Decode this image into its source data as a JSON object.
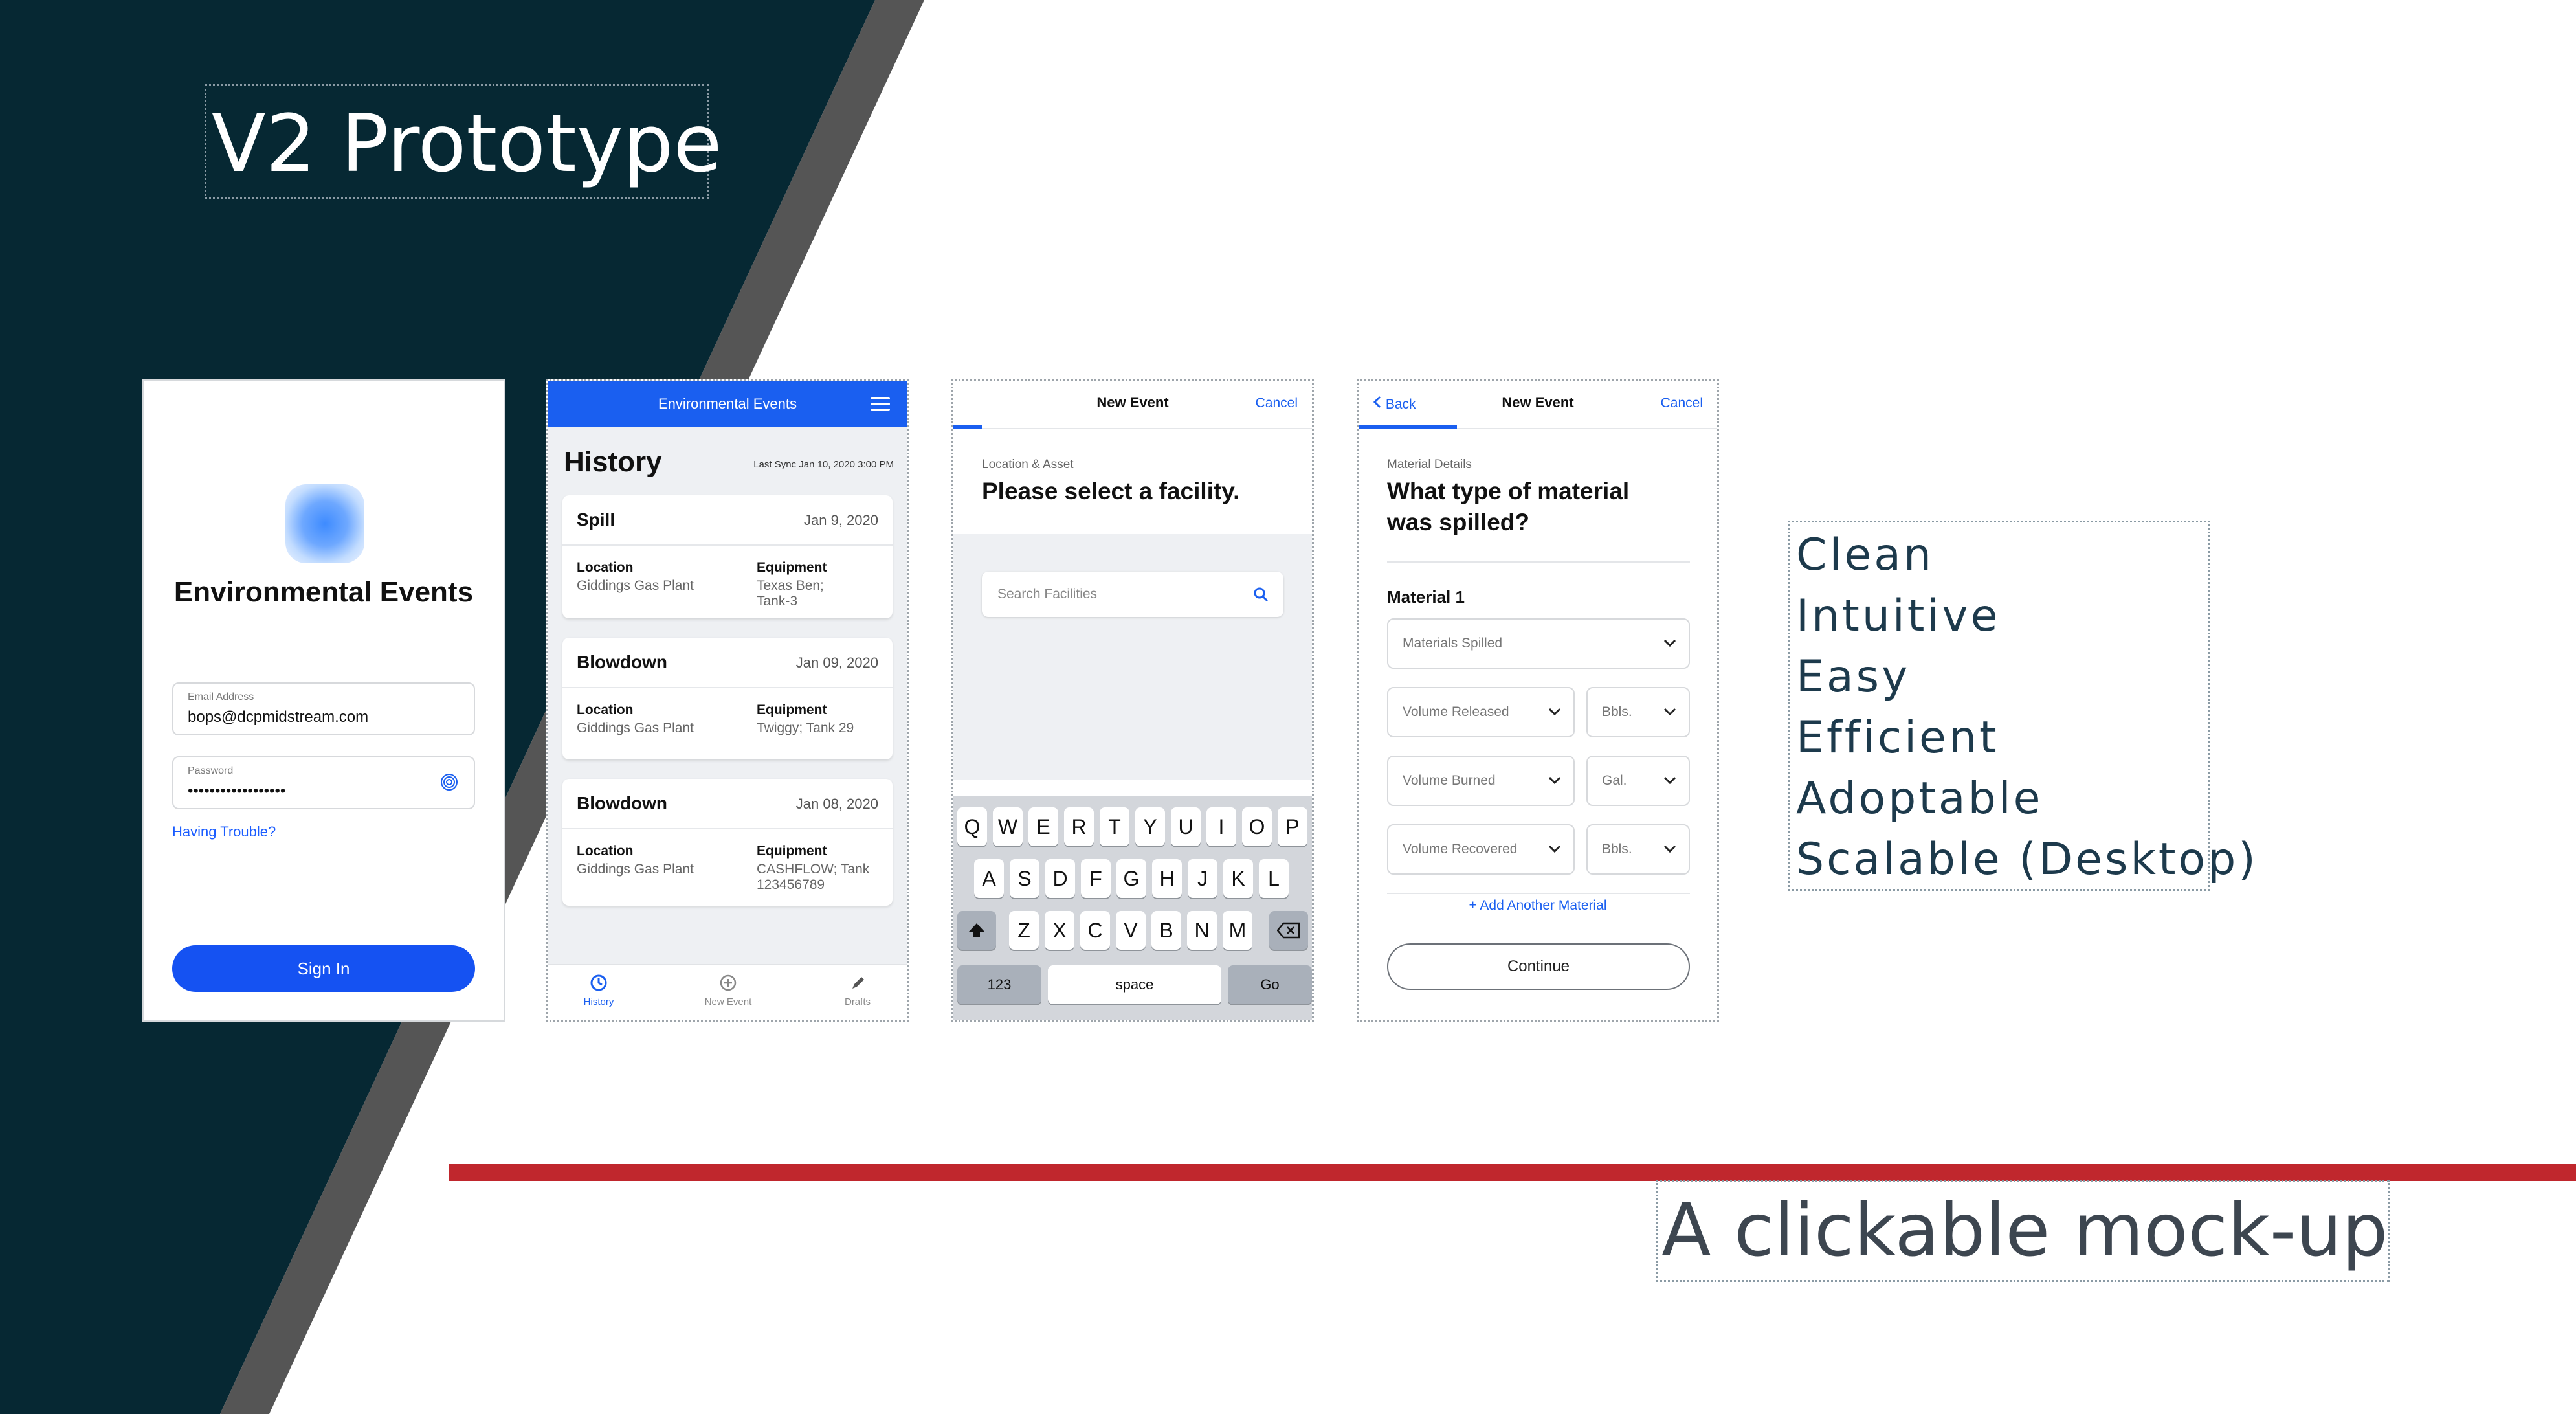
{
  "slide": {
    "title": "V2 Prototype",
    "features": [
      "Clean",
      "Intuitive",
      "Easy",
      "Efficient",
      "Adoptable",
      "Scalable (Desktop)"
    ],
    "subtitle": "A clickable  mock-up",
    "colors": {
      "dark_bg": "#062833",
      "stripe": "#555555",
      "accent_red": "#c0272d",
      "app_blue": "#1a5ff0"
    }
  },
  "login": {
    "app_name": "Environmental Events",
    "email_label": "Email Address",
    "email_value": "bops@dcpmidstream.com",
    "password_label": "Password",
    "password_value": "••••••••••••••••••",
    "trouble_link": "Having Trouble?",
    "sign_in": "Sign In",
    "icons": [
      "app-logo-icon",
      "fingerprint-icon"
    ]
  },
  "history": {
    "header": "Environmental Events",
    "title": "History",
    "last_sync": "Last Sync Jan 10, 2020 3:00 PM",
    "location_label": "Location",
    "equipment_label": "Equipment",
    "events": [
      {
        "type": "Spill",
        "date": "Jan 9, 2020",
        "location": "Giddings Gas Plant",
        "equipment": "Texas Ben; Tank-3"
      },
      {
        "type": "Blowdown",
        "date": "Jan 09, 2020",
        "location": "Giddings Gas Plant",
        "equipment": "Twiggy; Tank 29"
      },
      {
        "type": "Blowdown",
        "date": "Jan 08, 2020",
        "location": "Giddings Gas Plant",
        "equipment": "CASHFLOW; Tank 123456789"
      }
    ],
    "tabs": [
      "History",
      "New Event",
      "Drafts"
    ],
    "icons": [
      "menu-icon",
      "history-icon",
      "new-event-icon",
      "drafts-icon"
    ]
  },
  "facility": {
    "header": "New Event",
    "cancel": "Cancel",
    "section": "Location & Asset",
    "question": "Please select a facility.",
    "search_placeholder": "Search Facilities",
    "progress": 0.08,
    "keyboard": {
      "row1": [
        "Q",
        "W",
        "E",
        "R",
        "T",
        "Y",
        "U",
        "I",
        "O",
        "P"
      ],
      "row2": [
        "A",
        "S",
        "D",
        "F",
        "G",
        "H",
        "J",
        "K",
        "L"
      ],
      "row3": [
        "Z",
        "X",
        "C",
        "V",
        "B",
        "N",
        "M"
      ],
      "numbers": "123",
      "space": "space",
      "go": "Go"
    },
    "icons": [
      "search-icon",
      "shift-icon",
      "backspace-icon"
    ]
  },
  "material": {
    "back": "Back",
    "header": "New Event",
    "cancel": "Cancel",
    "section": "Material Details",
    "question_line1": "What type of material",
    "question_line2": "was spilled?",
    "material_label": "Material 1",
    "materials_spilled": "Materials Spilled",
    "progress": 0.28,
    "rows": [
      {
        "field": "Volume Released",
        "unit": "Bbls."
      },
      {
        "field": "Volume Burned",
        "unit": "Gal."
      },
      {
        "field": "Volume Recovered",
        "unit": "Bbls."
      }
    ],
    "add_material": "+ Add Another Material",
    "continue": "Continue",
    "icons": [
      "chevron-left-icon",
      "chevron-down-icon"
    ]
  }
}
